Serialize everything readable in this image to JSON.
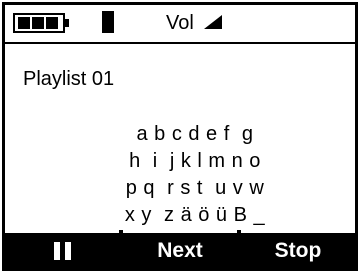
{
  "status": {
    "battery_icon": "battery-icon",
    "signal_icon": "signal-bar-icon",
    "volume_label": "Vol",
    "volume_icon": "volume-triangle-icon"
  },
  "playlist": {
    "title": "Playlist 01"
  },
  "keypad": {
    "rows": [
      "a b c d e f  g",
      "h  i  j k l m n o",
      "p q  r s t  u v w",
      "x y  z ä ö ü B _"
    ]
  },
  "softkeys": {
    "pause_icon": "pause-icon",
    "next_label": "Next",
    "stop_label": "Stop"
  }
}
